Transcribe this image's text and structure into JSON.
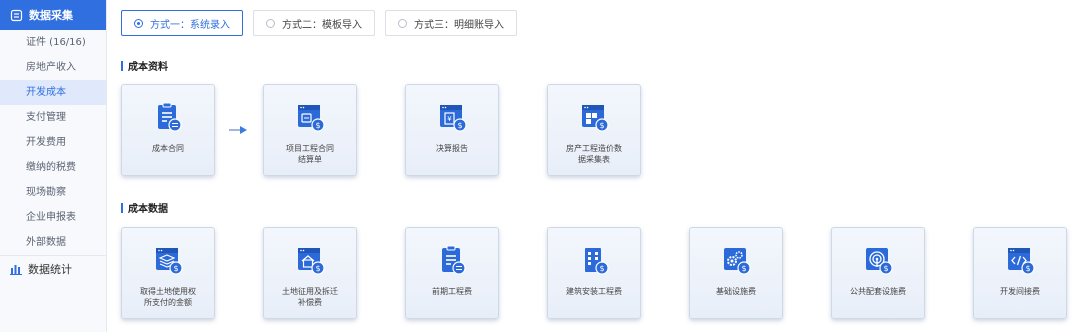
{
  "sidebar": {
    "header": "数据采集",
    "items": [
      {
        "label": "证件 (16/16)"
      },
      {
        "label": "房地产收入"
      },
      {
        "label": "开发成本"
      },
      {
        "label": "支付管理"
      },
      {
        "label": "开发费用"
      },
      {
        "label": "缴纳的税费"
      },
      {
        "label": "现场勘察"
      },
      {
        "label": "企业申报表"
      },
      {
        "label": "外部数据"
      }
    ],
    "active_item": "开发成本",
    "section2": "数据统计"
  },
  "mode_tabs": [
    {
      "label": "方式一：系统录入",
      "selected": true
    },
    {
      "label": "方式二：模板导入",
      "selected": false
    },
    {
      "label": "方式三：明细账导入",
      "selected": false
    }
  ],
  "cost_materials": {
    "title": "成本资料",
    "cards": [
      {
        "line1": "成本合同",
        "line2": "",
        "icon": "clipboard-icon"
      },
      {
        "line1": "项目工程合同",
        "line2": "结算单",
        "icon": "settlement-icon"
      },
      {
        "line1": "决算报告",
        "line2": "",
        "icon": "report-icon"
      },
      {
        "line1": "房产工程造价数",
        "line2": "据采集表",
        "icon": "cost-sheet-icon"
      }
    ]
  },
  "cost_data": {
    "title": "成本数据",
    "cards": [
      {
        "line1": "取得土地使用权",
        "line2": "所支付的金额",
        "icon": "land-layers-icon"
      },
      {
        "line1": "土地征用及拆迁",
        "line2": "补偿费",
        "icon": "house-icon"
      },
      {
        "line1": "前期工程费",
        "line2": "",
        "icon": "clipboard-icon"
      },
      {
        "line1": "建筑安装工程费",
        "line2": "",
        "icon": "building-icon"
      },
      {
        "line1": "基础设施费",
        "line2": "",
        "icon": "gears-icon"
      },
      {
        "line1": "公共配套设施费",
        "line2": "",
        "icon": "broadcast-icon"
      },
      {
        "line1": "开发间接费",
        "line2": "",
        "icon": "code-icon"
      }
    ]
  },
  "colors": {
    "accent": "#2f6fe0",
    "icon_blue": "#2b6ad8"
  }
}
